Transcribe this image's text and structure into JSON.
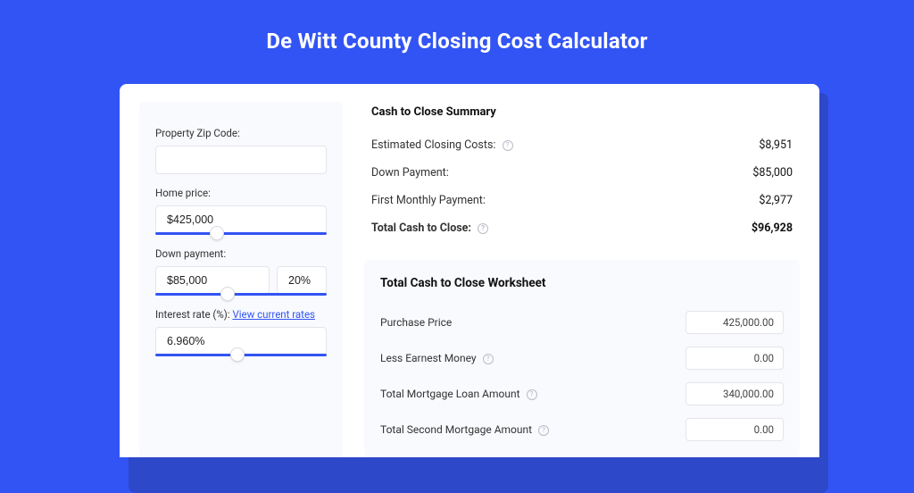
{
  "title": "De Witt County Closing Cost Calculator",
  "form": {
    "zip": {
      "label": "Property Zip Code:",
      "value": ""
    },
    "home_price": {
      "label": "Home price:",
      "value": "$425,000",
      "thumb_pct": 32
    },
    "down_payment": {
      "label": "Down payment:",
      "amount": "$85,000",
      "percent": "20%",
      "thumb_pct": 38
    },
    "interest_rate": {
      "label": "Interest rate (%):",
      "link": "View current rates",
      "value": "6.960%",
      "thumb_pct": 44
    }
  },
  "summary": {
    "title": "Cash to Close Summary",
    "rows": [
      {
        "label": "Estimated Closing Costs:",
        "help": true,
        "value": "$8,951"
      },
      {
        "label": "Down Payment:",
        "help": false,
        "value": "$85,000"
      },
      {
        "label": "First Monthly Payment:",
        "help": false,
        "value": "$2,977"
      }
    ],
    "total": {
      "label": "Total Cash to Close:",
      "help": true,
      "value": "$96,928"
    }
  },
  "worksheet": {
    "title": "Total Cash to Close Worksheet",
    "rows": [
      {
        "label": "Purchase Price",
        "help": false,
        "value": "425,000.00"
      },
      {
        "label": "Less Earnest Money",
        "help": true,
        "value": "0.00"
      },
      {
        "label": "Total Mortgage Loan Amount",
        "help": true,
        "value": "340,000.00"
      },
      {
        "label": "Total Second Mortgage Amount",
        "help": true,
        "value": "0.00"
      }
    ]
  }
}
